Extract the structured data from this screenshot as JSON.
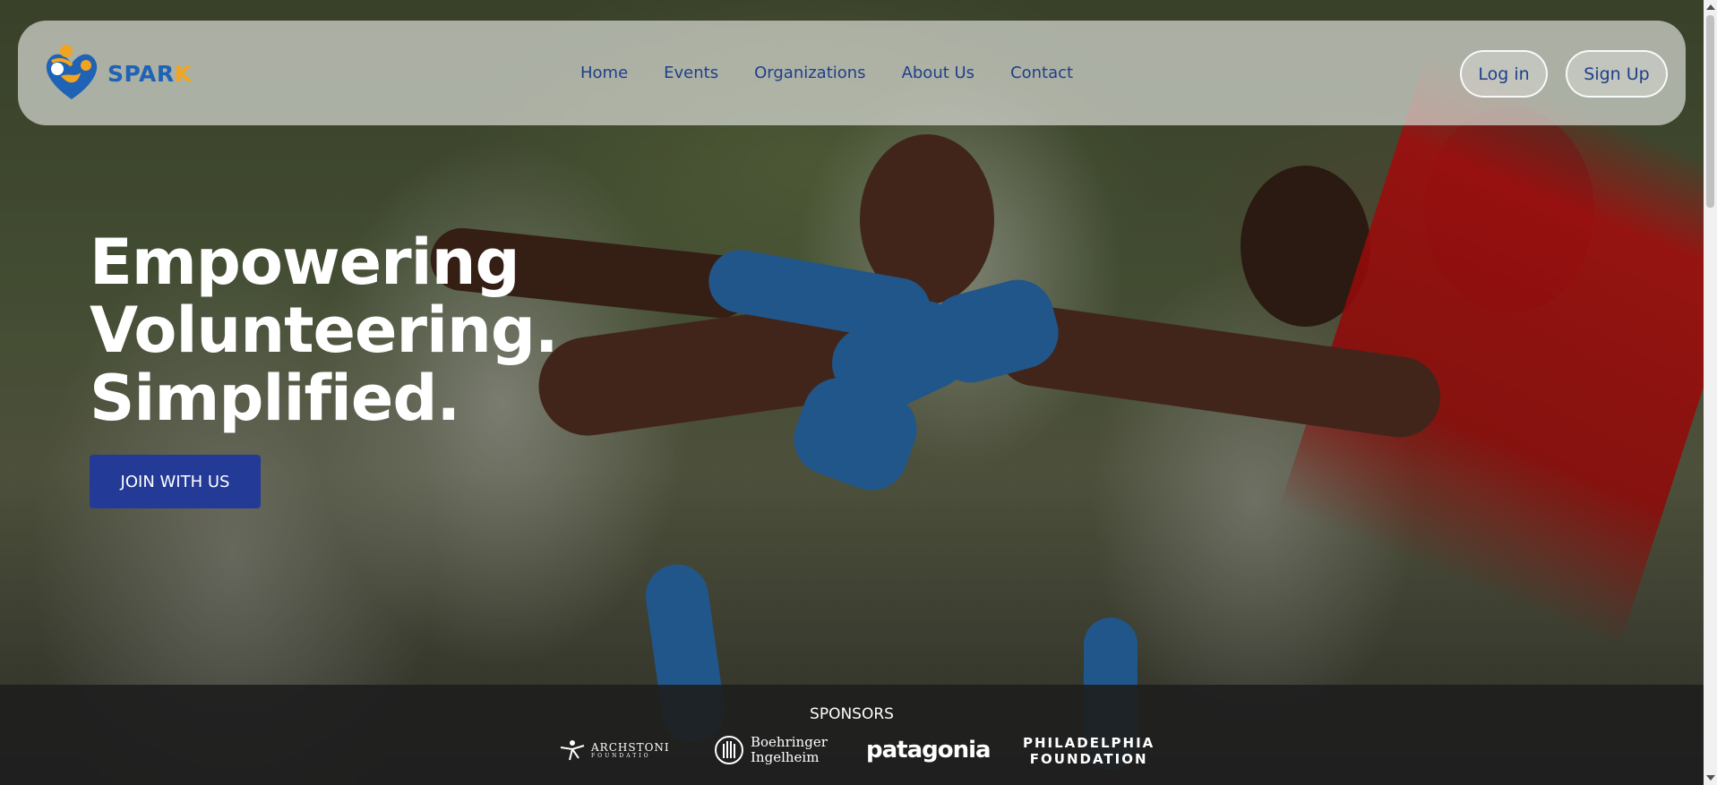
{
  "brand": {
    "logo_text_main": "SPAR",
    "logo_text_accent": "K",
    "primary_color": "#1e63b5",
    "accent_color": "#f2a41e"
  },
  "nav": {
    "links": [
      {
        "label": "Home"
      },
      {
        "label": "Events"
      },
      {
        "label": "Organizations"
      },
      {
        "label": "About Us"
      },
      {
        "label": "Contact"
      }
    ],
    "login_label": "Log in",
    "signup_label": "Sign Up"
  },
  "hero": {
    "title_lines": [
      "Empowering",
      "Volunteering.",
      "Simplified."
    ],
    "cta_label": "JOIN WITH US",
    "cta_color": "#233a97"
  },
  "sponsors": {
    "title": "SPONSORS",
    "items": [
      {
        "name": "ARCHSTONI",
        "sub": "FOUNDATIO"
      },
      {
        "name": "Boehringer",
        "sub": "Ingelheim"
      },
      {
        "name": "patagonia"
      },
      {
        "name": "PHILADELPHIA",
        "sub": "FOUNDATION"
      }
    ]
  }
}
